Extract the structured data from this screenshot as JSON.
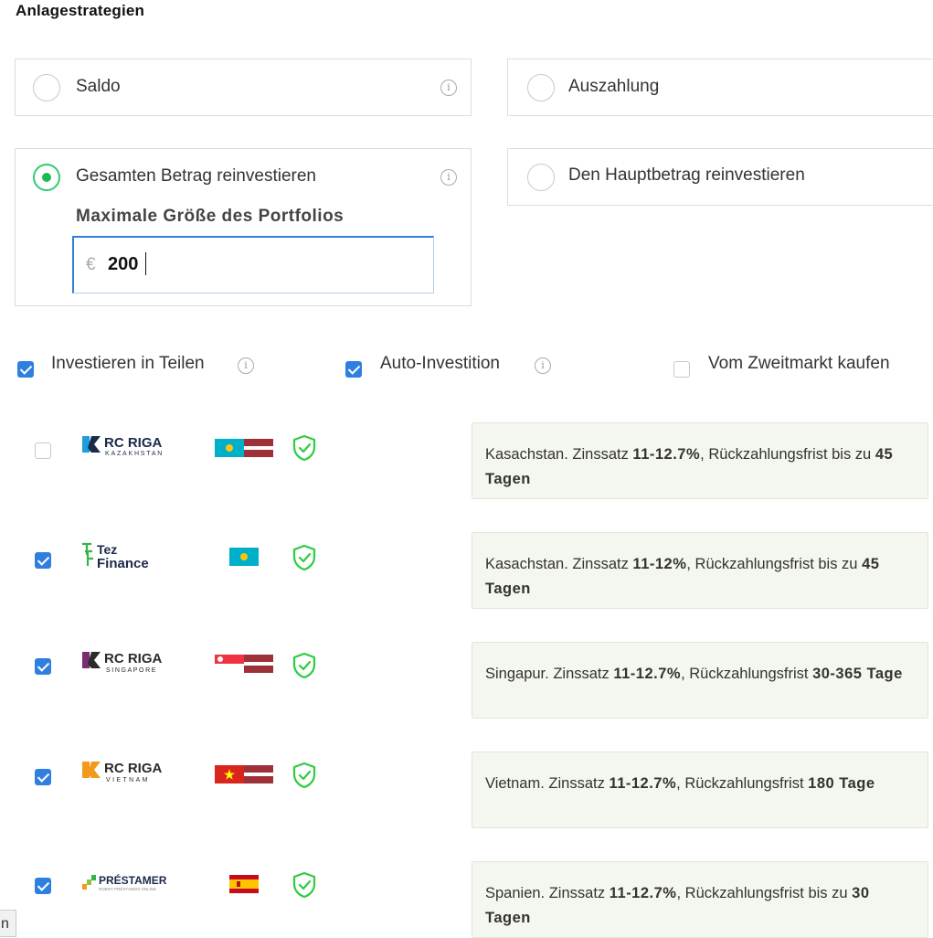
{
  "page": {
    "title": "Anlagestrategien"
  },
  "strategies": {
    "saldo": {
      "label": "Saldo",
      "selected": false
    },
    "auszahlung": {
      "label": "Auszahlung",
      "selected": false
    },
    "gesamt": {
      "label": "Gesamten Betrag reinvestieren",
      "selected": true,
      "portfolio_label": "Maximale Größe des Portfolios",
      "currency": "€",
      "amount": "200"
    },
    "haupt": {
      "label": "Den Hauptbetrag reinvestieren",
      "selected": false
    }
  },
  "options": {
    "teilen": {
      "label": "Investieren in Teilen",
      "checked": true
    },
    "auto": {
      "label": "Auto-Investition",
      "checked": true
    },
    "zweitmarkt": {
      "label": "Vom Zweitmarkt kaufen",
      "checked": false
    }
  },
  "lenders": [
    {
      "name": "RC RIGA",
      "sub": "KAZAKHSTAN",
      "checked": false,
      "country": "Kasachstan.",
      "rate_prefix": " Zinssatz ",
      "rate": "11-12.7%",
      "term_prefix": ", Rückzahlungsfrist bis zu ",
      "term": "45 Tagen",
      "term_suffix": "",
      "color_a": "#1f9fd9",
      "color_b": "#1b2a4a"
    },
    {
      "name": "Tez Finance",
      "name_line1": "Tez",
      "name_line2": "Finance",
      "checked": true,
      "country": "Kasachstan.",
      "rate_prefix": " Zinssatz ",
      "rate": "11-12%",
      "term_prefix": ", Rückzahlungsfrist bis zu ",
      "term": "45 Tagen",
      "term_suffix": "",
      "color_a": "#37b34a"
    },
    {
      "name": "RC RIGA",
      "sub": "SINGAPORE",
      "checked": true,
      "country": "Singapur.",
      "rate_prefix": " Zinssatz ",
      "rate": "11-12.7%",
      "term_prefix": ", Rückzahlungsfrist ",
      "term": "30-365 Tage",
      "term_suffix": "",
      "color_a": "#7b2d73",
      "color_b": "#2b2b2b"
    },
    {
      "name": "RC RIGA",
      "sub": "VIETNAM",
      "checked": true,
      "country": "Vietnam.",
      "rate_prefix": " Zinssatz ",
      "rate": "11-12.7%",
      "term_prefix": ", Rückzahlungsfrist ",
      "term": "180 Tage",
      "term_suffix": "",
      "color_a": "#f39a1c",
      "color_b": "#2b2b2b"
    },
    {
      "name": "PRÉSTAMER",
      "sub": "ROBOT PRÉSTAMOS ONLINE",
      "checked": true,
      "country": "Spanien.",
      "rate_prefix": " Zinssatz ",
      "rate": "11-12.7%",
      "term_prefix": ", Rückzahlungsfrist bis zu ",
      "term": "30 Tagen",
      "term_suffix": "",
      "color_a": "#8cc63f"
    }
  ],
  "corner_text": "n",
  "colors": {
    "accent": "#2f7fe0",
    "selected_radio": "#1db954",
    "shield": "#2ecc40",
    "infobox_bg": "#f4f6f0"
  }
}
